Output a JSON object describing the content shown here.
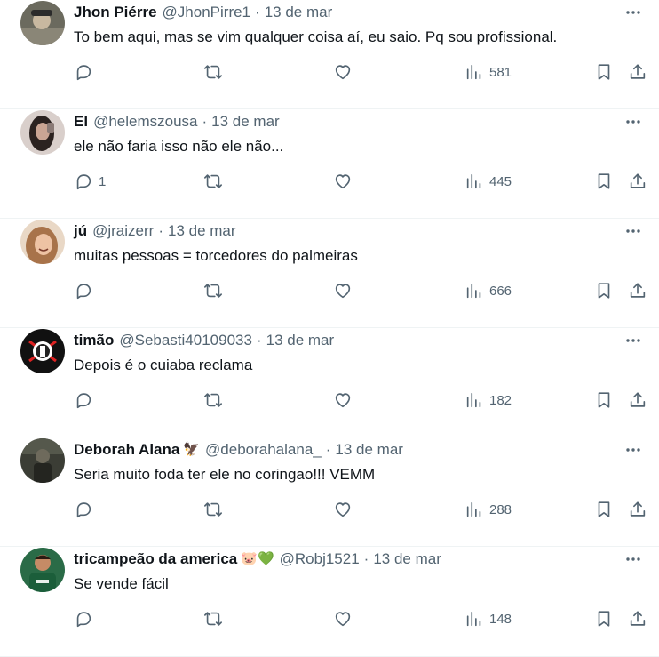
{
  "tweets": [
    {
      "name": "Jhon Piérre",
      "badge": "",
      "handle": "@JhonPirre1",
      "date": "13 de mar",
      "text": "To bem aqui, mas se vim qualquer coisa aí, eu saio. Pq sou profissional.",
      "replies": "",
      "views": "581",
      "avatar_color": "#6b6a5e"
    },
    {
      "name": "El",
      "badge": "",
      "handle": "@helemszousa",
      "date": "13 de mar",
      "text": "ele não faria isso não ele não...",
      "replies": "1",
      "views": "445",
      "avatar_color": "#b59a93"
    },
    {
      "name": "jú",
      "badge": "",
      "handle": "@jraizerr",
      "date": "13 de mar",
      "text": "muitas pessoas = torcedores do palmeiras",
      "replies": "",
      "views": "666",
      "avatar_color": "#c9a58a"
    },
    {
      "name": "timão",
      "badge": "",
      "handle": "@Sebasti40109033",
      "date": "13 de mar",
      "text": "Depois é o cuiaba reclama",
      "replies": "",
      "views": "182",
      "avatar_color": "#111111"
    },
    {
      "name": "Deborah Alana",
      "badge": "🦅",
      "handle": "@deborahalana_",
      "date": "13 de mar",
      "text": "Seria muito foda ter ele no coringao!!! VEMM",
      "replies": "",
      "views": "288",
      "avatar_color": "#3b3d35"
    },
    {
      "name": "tricampeão da america",
      "badge": "🐷💚",
      "handle": "@Robj1521",
      "date": "13 de mar",
      "text": "Se vende fácil",
      "replies": "",
      "views": "148",
      "avatar_color": "#1b5e3a"
    }
  ],
  "separator": "·"
}
